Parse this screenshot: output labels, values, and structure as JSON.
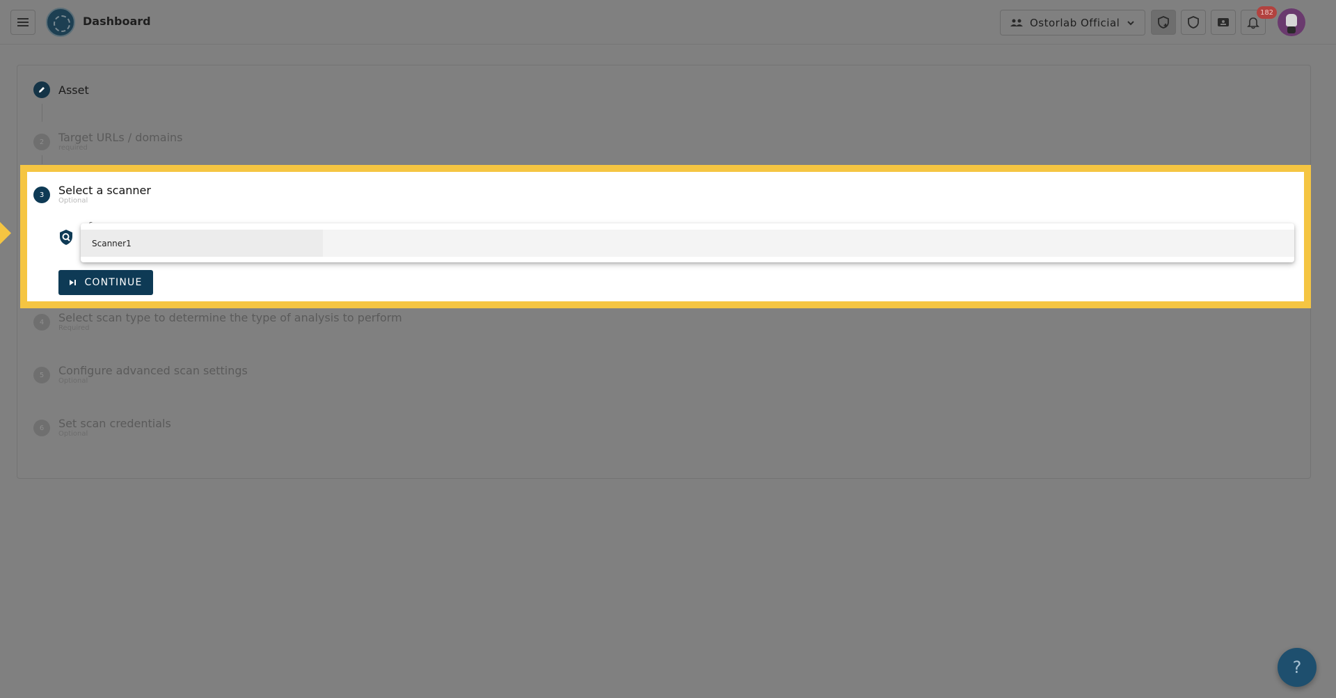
{
  "header": {
    "title": "Dashboard",
    "org_name": "Ostorlab Official",
    "notification_count": "182",
    "icons": [
      "menu-icon",
      "logo",
      "team-icon",
      "chevron-down-icon",
      "new-scan-icon",
      "shield-icon",
      "id-card-icon",
      "bell-icon",
      "avatar"
    ]
  },
  "steps": [
    {
      "number": "",
      "title": "Asset",
      "sub": "",
      "status": "done"
    },
    {
      "number": "2",
      "title": "Target URLs / domains",
      "sub": "required",
      "status": "inactive"
    },
    {
      "number": "3",
      "title": "Select a scanner",
      "sub": "Optional",
      "status": "active"
    },
    {
      "number": "4",
      "title": "Select scan type to determine the type of analysis to perform",
      "sub": "Required",
      "status": "inactive"
    },
    {
      "number": "5",
      "title": "Configure advanced scan settings",
      "sub": "Optional",
      "status": "inactive"
    },
    {
      "number": "6",
      "title": "Set scan credentials",
      "sub": "Optional",
      "status": "inactive"
    }
  ],
  "scanner": {
    "field_label": "S",
    "options": [
      "Scanner1"
    ]
  },
  "continue_label": "CONTINUE",
  "help_label": "?",
  "colors": {
    "accent": "#0e3a55",
    "highlight": "#f5c542",
    "overlay": "#808080",
    "badge": "#b2423f"
  }
}
